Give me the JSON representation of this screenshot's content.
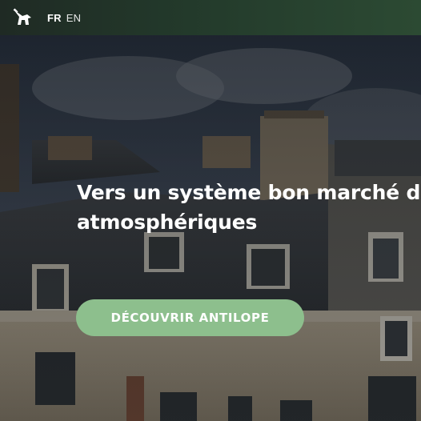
{
  "header": {
    "logo_icon": "antelope-logo-icon",
    "languages": [
      {
        "code": "FR",
        "active": true
      },
      {
        "code": "EN",
        "active": false
      }
    ]
  },
  "hero": {
    "headline_line1": "Vers un système bon marché d",
    "headline_line2": "atmosphériques",
    "cta_label": "DÉCOUVRIR ANTILOPE"
  },
  "colors": {
    "topbar": "#233a2b",
    "cta_background": "#8dbf8d",
    "text": "#ffffff"
  }
}
